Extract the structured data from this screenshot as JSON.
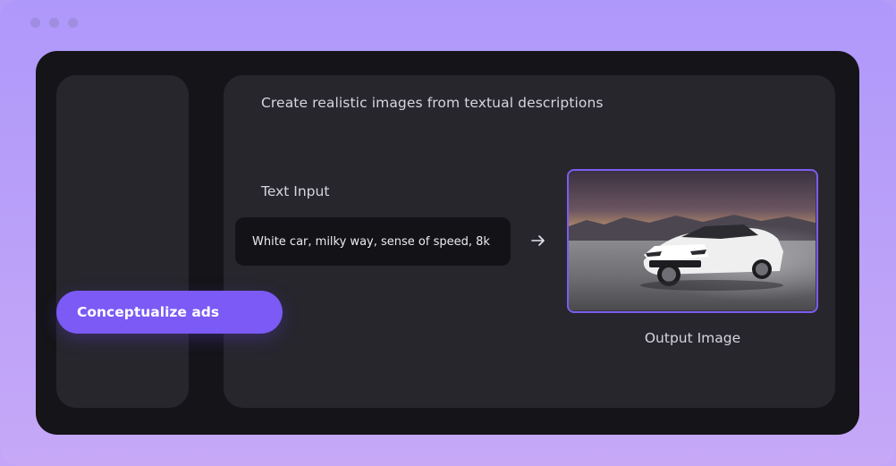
{
  "window": {
    "controls": [
      "dot",
      "dot",
      "dot"
    ]
  },
  "main": {
    "headline": "Create realistic images from textual descriptions",
    "text_input_label": "Text Input",
    "prompt": "White car, milky way, sense of speed, 8k",
    "arrow_icon": "arrow-right-icon",
    "output_label": "Output Image"
  },
  "sidebar": {
    "pill_label": "Conceptualize ads"
  },
  "colors": {
    "background": "#b39bf8",
    "window": "#151418",
    "panel": "#27262d",
    "accent": "#7b5af5"
  }
}
